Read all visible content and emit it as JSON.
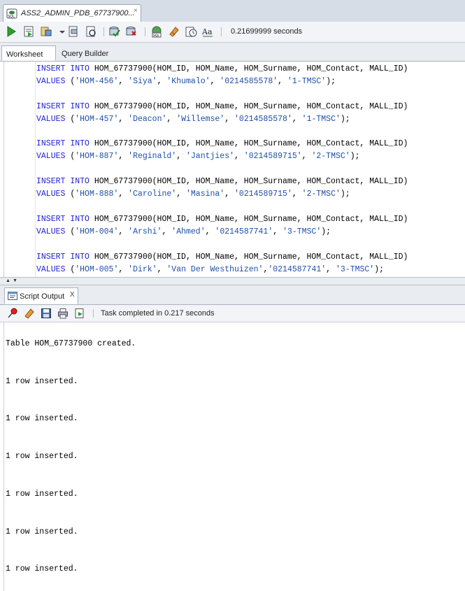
{
  "document_tab": {
    "title": "ASS2_ADMIN_PDB_67737900...",
    "close": "×"
  },
  "toolbar": {
    "timing": "0.21699999 seconds"
  },
  "subtabs": {
    "worksheet": "Worksheet",
    "query_builder": "Query Builder"
  },
  "editor": {
    "statements": [
      {
        "insert": "INSERT INTO HOM_67737900(HOM_ID, HOM_Name, HOM_Surname, HOM_Contact, MALL_ID)",
        "values": "VALUES ('HOM-456', 'Siya', 'Khumalo', '0214585578', '1-TMSC');"
      },
      {
        "insert": "INSERT INTO HOM_67737900(HOM_ID, HOM_Name, HOM_Surname, HOM_Contact, MALL_ID)",
        "values": "VALUES ('HOM-457', 'Deacon', 'Willemse', '0214585578', '1-TMSC');"
      },
      {
        "insert": "INSERT INTO HOM_67737900(HOM_ID, HOM_Name, HOM_Surname, HOM_Contact, MALL_ID)",
        "values": "VALUES ('HOM-887', 'Reginald', 'Jantjies', '0214589715', '2-TMSC');"
      },
      {
        "insert": "INSERT INTO HOM_67737900(HOM_ID, HOM_Name, HOM_Surname, HOM_Contact, MALL_ID)",
        "values": "VALUES ('HOM-888', 'Caroline', 'Masina', '0214589715', '2-TMSC');"
      },
      {
        "insert": "INSERT INTO HOM_67737900(HOM_ID, HOM_Name, HOM_Surname, HOM_Contact, MALL_ID)",
        "values": "VALUES ('HOM-004', 'Arshi', 'Ahmed', '0214587741', '3-TMSC');"
      },
      {
        "insert": "INSERT INTO HOM_67737900(HOM_ID, HOM_Name, HOM_Surname, HOM_Contact, MALL_ID)",
        "values": "VALUES ('HOM-005', 'Dirk', 'Van Der Westhuizen','0214587741', '3-TMSC');"
      }
    ]
  },
  "output_panel": {
    "tab_label": "Script Output",
    "tab_close": "X",
    "status": "Task completed in 0.217 seconds",
    "lines": [
      "Table HOM_67737900 created.",
      "1 row inserted.",
      "1 row inserted.",
      "1 row inserted.",
      "1 row inserted.",
      "1 row inserted.",
      "1 row inserted."
    ]
  },
  "icons": {
    "run": "run-statement-icon",
    "run_script": "run-script-icon",
    "autotrace": "autotrace-icon",
    "explain": "explain-plan-icon",
    "commit": "commit-icon",
    "rollback": "rollback-icon",
    "sql_tuning": "sql-tuning-icon",
    "clear": "clear-eraser-icon",
    "history": "sql-history-icon",
    "format": "format-case-icon"
  }
}
